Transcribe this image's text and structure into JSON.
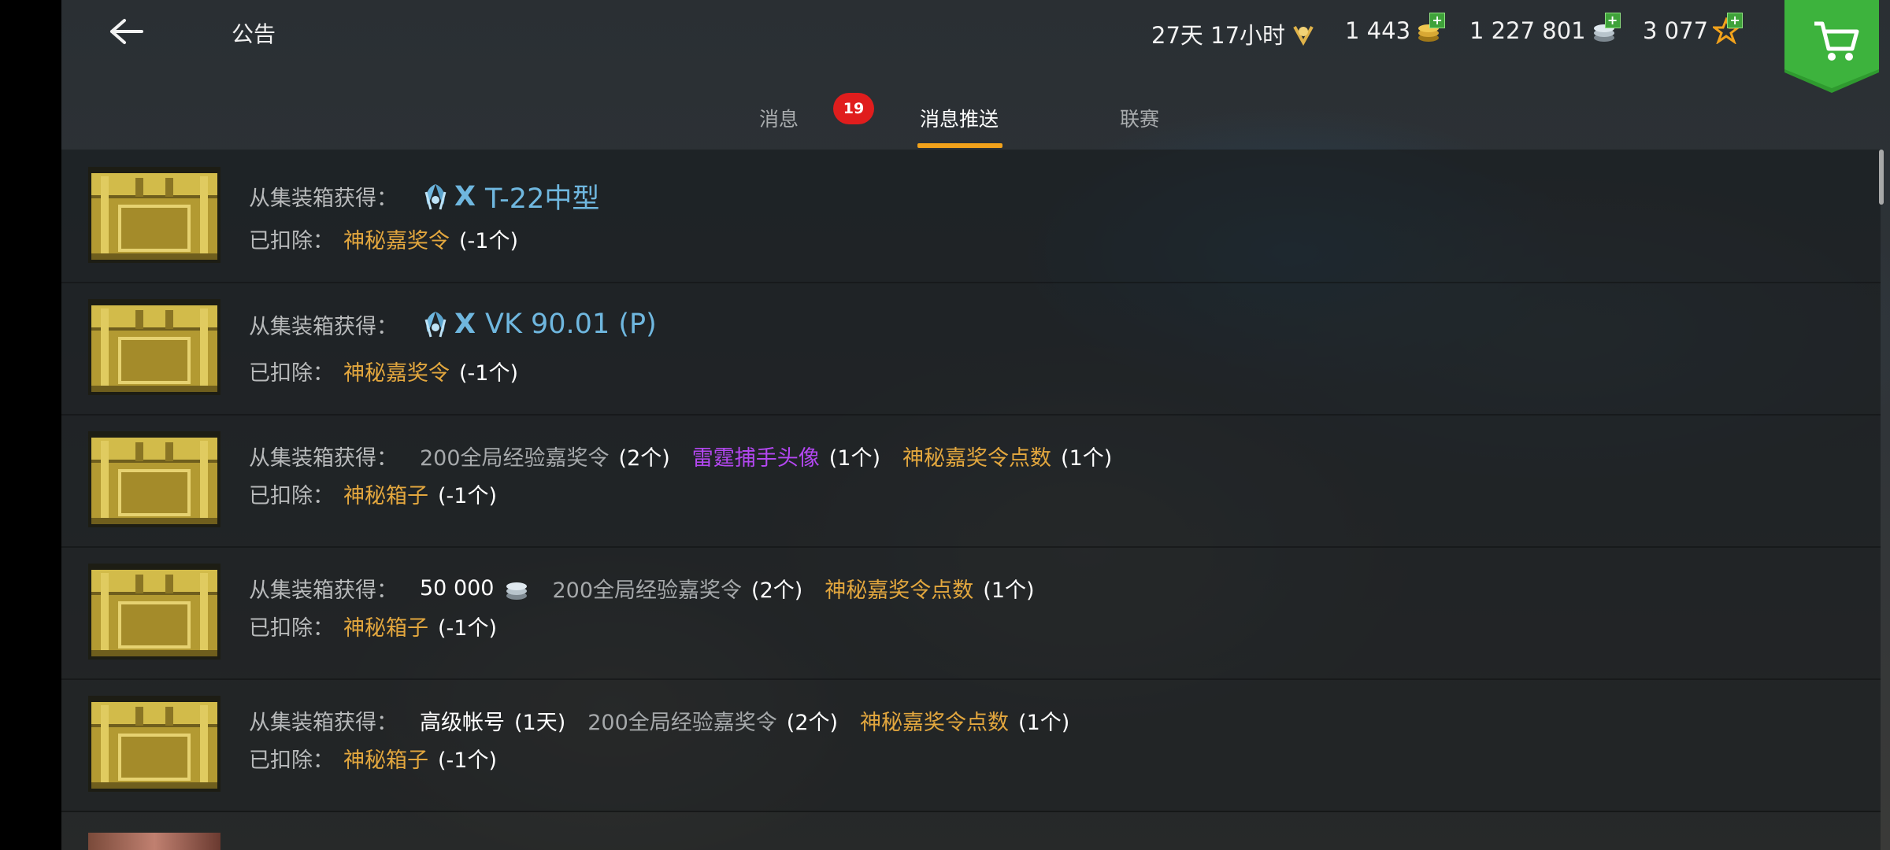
{
  "header": {
    "title": "公告",
    "timer": "27天 17小时",
    "gold": "1 443",
    "silver": "1 227 801",
    "free_xp": "3 077"
  },
  "tabs": [
    {
      "label": "消息",
      "badge": "19"
    },
    {
      "label": "消息推送"
    },
    {
      "label": "联赛"
    }
  ],
  "colors": {
    "accent": "#f2a21b",
    "gold_text": "#e3a73e",
    "purple_text": "#b347f0",
    "vehicle_blue": "#6fb7df",
    "badge_red": "#e01d1d",
    "shop_green": "#2f9a2f"
  },
  "rows": [
    {
      "from_label": "从集装箱获得：",
      "tier": "X",
      "vehicle": "T-22中型",
      "deduct_label": "已扣除：",
      "deduct_item": "神秘嘉奖令",
      "deduct_qty": "(-1个)"
    },
    {
      "from_label": "从集装箱获得：",
      "tier": "X",
      "vehicle": "VK 90.01 (P)",
      "deduct_label": "已扣除：",
      "deduct_item": "神秘嘉奖令",
      "deduct_qty": "(-1个)"
    },
    {
      "from_label": "从集装箱获得：",
      "rewards": [
        {
          "name": "200全局经验嘉奖令",
          "qty": "(2个)"
        },
        {
          "name": "雷霆捕手头像",
          "qty": "(1个)"
        },
        {
          "name": "神秘嘉奖令点数",
          "qty": "(1个)"
        }
      ],
      "deduct_label": "已扣除：",
      "deduct_item": "神秘箱子",
      "deduct_qty": "(-1个)"
    },
    {
      "from_label": "从集装箱获得：",
      "silver_amount": "50 000",
      "rewards": [
        {
          "name": "200全局经验嘉奖令",
          "qty": "(2个)"
        },
        {
          "name": "神秘嘉奖令点数",
          "qty": "(1个)"
        }
      ],
      "deduct_label": "已扣除：",
      "deduct_item": "神秘箱子",
      "deduct_qty": "(-1个)"
    },
    {
      "from_label": "从集装箱获得：",
      "premium": {
        "name": "高级帐号",
        "qty": "(1天)"
      },
      "rewards": [
        {
          "name": "200全局经验嘉奖令",
          "qty": "(2个)"
        },
        {
          "name": "神秘嘉奖令点数",
          "qty": "(1个)"
        }
      ],
      "deduct_label": "已扣除：",
      "deduct_item": "神秘箱子",
      "deduct_qty": "(-1个)"
    }
  ]
}
